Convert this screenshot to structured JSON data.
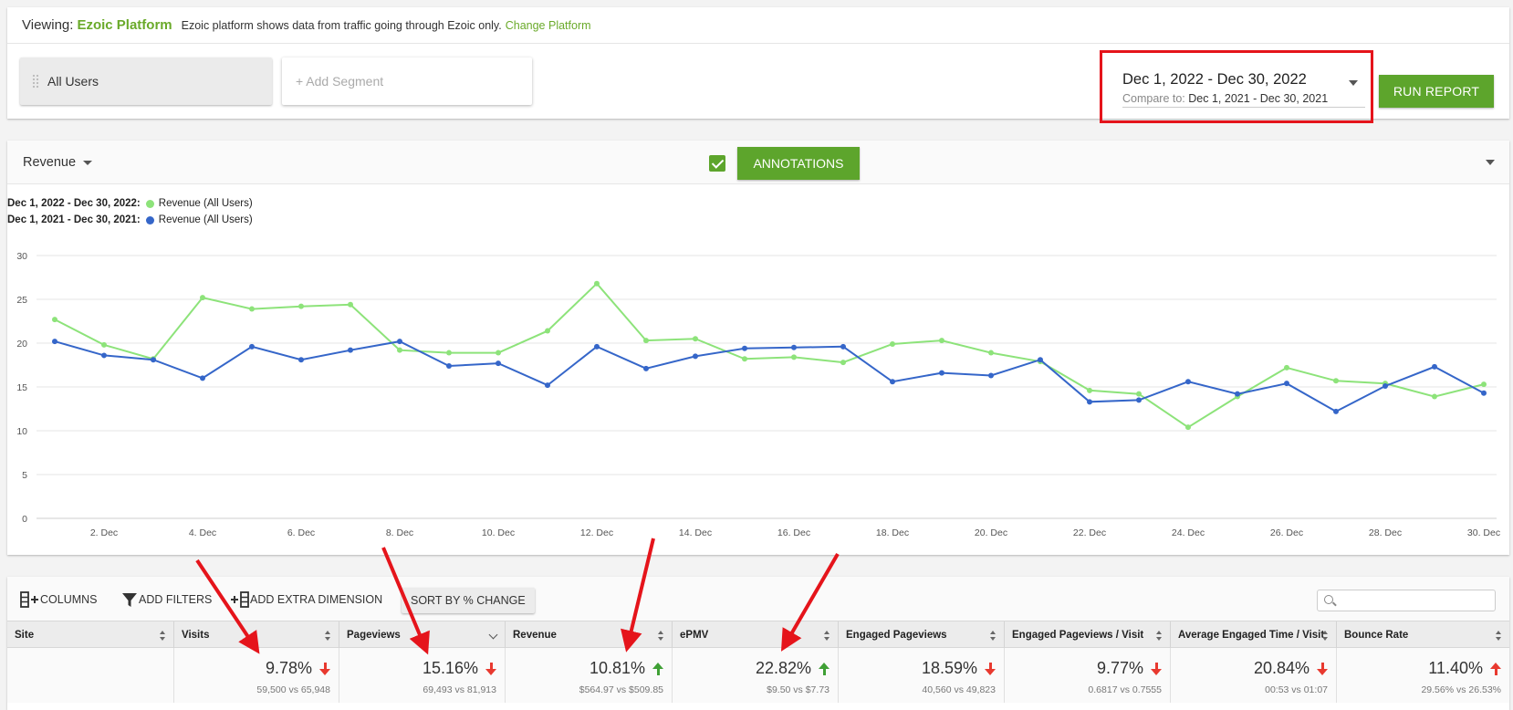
{
  "viewing": {
    "label": "Viewing:",
    "platform": "Ezoic Platform",
    "description": "Ezoic platform shows data from traffic going through Ezoic only.",
    "change_link": "Change Platform"
  },
  "segments": {
    "active": "All Users",
    "add_placeholder": "+ Add Segment"
  },
  "date_range": {
    "main": "Dec 1, 2022 - Dec 30, 2022",
    "compare_label": "Compare to:",
    "compare_value": "Dec 1, 2021 - Dec 30, 2021"
  },
  "run_report_label": "RUN REPORT",
  "chart_header": {
    "metric": "Revenue",
    "annotations_label": "ANNOTATIONS",
    "annotations_checked": true
  },
  "legend": [
    {
      "range": "Dec 1, 2022 - Dec 30, 2022:",
      "series": "Revenue (All Users)",
      "color": "#8de37a"
    },
    {
      "range": "Dec 1, 2021 - Dec 30, 2021:",
      "series": "Revenue (All Users)",
      "color": "#3566c9"
    }
  ],
  "chart_data": {
    "type": "line",
    "x_ticks": [
      "2. Dec",
      "4. Dec",
      "6. Dec",
      "8. Dec",
      "10. Dec",
      "12. Dec",
      "14. Dec",
      "16. Dec",
      "18. Dec",
      "20. Dec",
      "22. Dec",
      "24. Dec",
      "26. Dec",
      "28. Dec",
      "30. Dec"
    ],
    "y_ticks": [
      0,
      5,
      10,
      15,
      20,
      25,
      30
    ],
    "ylim": [
      0,
      30
    ],
    "x_days": [
      1,
      30
    ],
    "grid": true,
    "series": [
      {
        "name": "Dec 1, 2022 - Dec 30, 2022: Revenue (All Users)",
        "color": "#8de37a",
        "values": [
          22.7,
          19.8,
          18.2,
          25.2,
          23.9,
          24.2,
          24.4,
          19.2,
          18.9,
          18.9,
          21.4,
          26.8,
          20.3,
          20.5,
          18.2,
          18.4,
          17.8,
          19.9,
          20.3,
          18.9,
          17.9,
          14.6,
          14.2,
          10.4,
          13.9,
          17.2,
          15.7,
          15.4,
          13.9,
          15.3
        ]
      },
      {
        "name": "Dec 1, 2021 - Dec 30, 2021: Revenue (All Users)",
        "color": "#3566c9",
        "values": [
          20.2,
          18.6,
          18.1,
          16.0,
          19.6,
          18.1,
          19.2,
          20.2,
          17.4,
          17.7,
          15.2,
          19.6,
          17.1,
          18.5,
          19.4,
          19.5,
          19.6,
          15.6,
          16.6,
          16.3,
          18.1,
          13.3,
          13.5,
          15.6,
          14.2,
          15.4,
          12.2,
          15.1,
          17.3,
          14.3
        ]
      }
    ]
  },
  "toolbar": {
    "columns": "COLUMNS",
    "filters": "ADD FILTERS",
    "dimension": "ADD EXTRA DIMENSION",
    "sort": "SORT BY % CHANGE"
  },
  "table": {
    "headers": [
      "Site",
      "Visits",
      "Pageviews",
      "Revenue",
      "ePMV",
      "Engaged Pageviews",
      "Engaged Pageviews / Visit",
      "Average Engaged Time / Visit",
      "Bounce Rate"
    ],
    "row": [
      {
        "pct": "",
        "cmp": ""
      },
      {
        "pct": "9.78%",
        "dir": "down",
        "cmp": "59,500 vs 65,948"
      },
      {
        "pct": "15.16%",
        "dir": "down",
        "cmp": "69,493 vs 81,913"
      },
      {
        "pct": "10.81%",
        "dir": "up",
        "cmp": "$564.97 vs $509.85"
      },
      {
        "pct": "22.82%",
        "dir": "up",
        "cmp": "$9.50 vs $7.73"
      },
      {
        "pct": "18.59%",
        "dir": "down",
        "cmp": "40,560 vs 49,823"
      },
      {
        "pct": "9.77%",
        "dir": "down",
        "cmp": "0.6817 vs 0.7555"
      },
      {
        "pct": "20.84%",
        "dir": "down",
        "cmp": "00:53 vs 01:07"
      },
      {
        "pct": "11.40%",
        "dir": "up-red",
        "cmp": "29.56% vs 26.53%"
      }
    ]
  },
  "colors": {
    "accent_green": "#5da52c",
    "highlight_red": "#e5141b",
    "arrow_red": "#e8392f",
    "arrow_green": "#3fa035"
  }
}
